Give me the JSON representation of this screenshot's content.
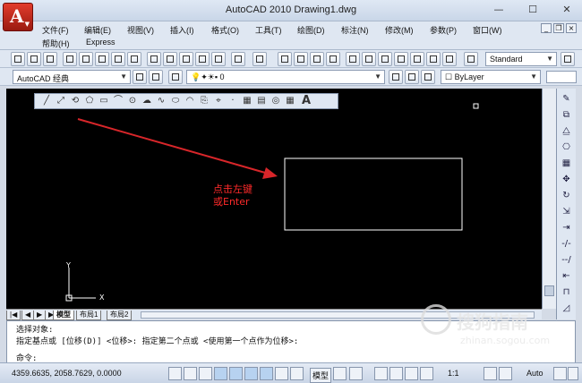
{
  "window": {
    "title": "AutoCAD 2010        Drawing1.dwg",
    "app_icon_letter": "A",
    "controls": [
      "—",
      "☐",
      "✕"
    ]
  },
  "menu": {
    "items": [
      "文件(F)",
      "编辑(E)",
      "视图(V)",
      "插入(I)",
      "格式(O)",
      "工具(T)",
      "绘图(D)",
      "标注(N)",
      "修改(M)",
      "参数(P)",
      "窗口(W)",
      "帮助(H)",
      "Express"
    ]
  },
  "toolbar": {
    "text_style": "Standard",
    "workspace": "AutoCAD 经典",
    "layer": "0",
    "color": "ByLayer",
    "text_style_icon": "text-style-icon"
  },
  "canvas": {
    "annotation_line1": "点击左键",
    "annotation_line2": "或Enter",
    "ucs_y": "Y",
    "ucs_x": "X",
    "background": "#000000",
    "annotation_color": "#ff2a2a",
    "arrow_color": "#d8262a"
  },
  "draw_toolbar": {
    "text_tool": "A"
  },
  "tabs": {
    "nav": [
      "|◀",
      "◀",
      "▶",
      "▶|"
    ],
    "items": [
      "模型",
      "布局1",
      "布局2"
    ],
    "active": "模型"
  },
  "command": {
    "line1": "选择对象:",
    "line2": "指定基点或 [位移(D)] <位移>:  指定第二个点或 <使用第一个点作为位移>:",
    "prompt": "命令:"
  },
  "status": {
    "coordinates": "4359.6635, 2058.7629, 0.0000",
    "model_label": "模型",
    "scale": "1:1",
    "auto": "Auto"
  },
  "watermark": {
    "text": "搜狗指南",
    "url": "zhinan.sogou.com"
  }
}
